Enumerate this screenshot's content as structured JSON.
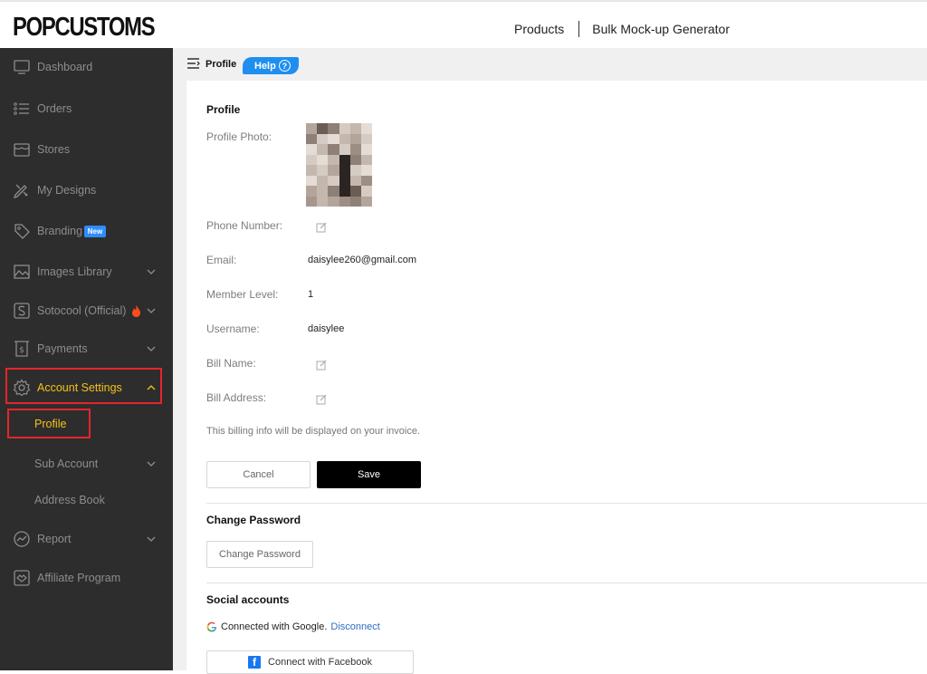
{
  "brand": {
    "name": "POPCUSTOMS"
  },
  "topnav": {
    "products": "Products",
    "generator": "Bulk Mock-up Generator"
  },
  "sidebar": {
    "items": [
      {
        "label": "Dashboard"
      },
      {
        "label": "Orders"
      },
      {
        "label": "Stores"
      },
      {
        "label": "My Designs"
      },
      {
        "label": "Branding",
        "badge": "New"
      },
      {
        "label": "Images Library"
      },
      {
        "label": "Sotocool (Official)"
      },
      {
        "label": "Payments"
      },
      {
        "label": "Account Settings"
      },
      {
        "label": "Report"
      },
      {
        "label": "Affiliate Program"
      }
    ],
    "sub_items": [
      {
        "label": "Profile"
      },
      {
        "label": "Sub Account"
      },
      {
        "label": "Address Book"
      }
    ]
  },
  "breadcrumb": {
    "title": "Profile",
    "help": "Help"
  },
  "profile": {
    "heading": "Profile",
    "photo_label": "Profile Photo:",
    "phone_label": "Phone Number:",
    "email_label": "Email:",
    "email_value": "daisylee260@gmail.com",
    "level_label": "Member Level:",
    "level_value": "1",
    "username_label": "Username:",
    "username_value": "daisylee",
    "bill_name_label": "Bill Name:",
    "bill_address_label": "Bill Address:",
    "billing_note": "This billing info will be displayed on your invoice.",
    "cancel_label": "Cancel",
    "save_label": "Save"
  },
  "password": {
    "heading": "Change Password",
    "button_label": "Change Password"
  },
  "social": {
    "heading": "Social accounts",
    "google_text": "Connected with Google.",
    "disconnect_label": "Disconnect",
    "facebook_label": "Connect with Facebook"
  },
  "colors": {
    "sidebar_bg": "#2d2d2d",
    "active": "#f3c21b",
    "help": "#1f8ef1",
    "highlight_box": "#e5252a"
  }
}
